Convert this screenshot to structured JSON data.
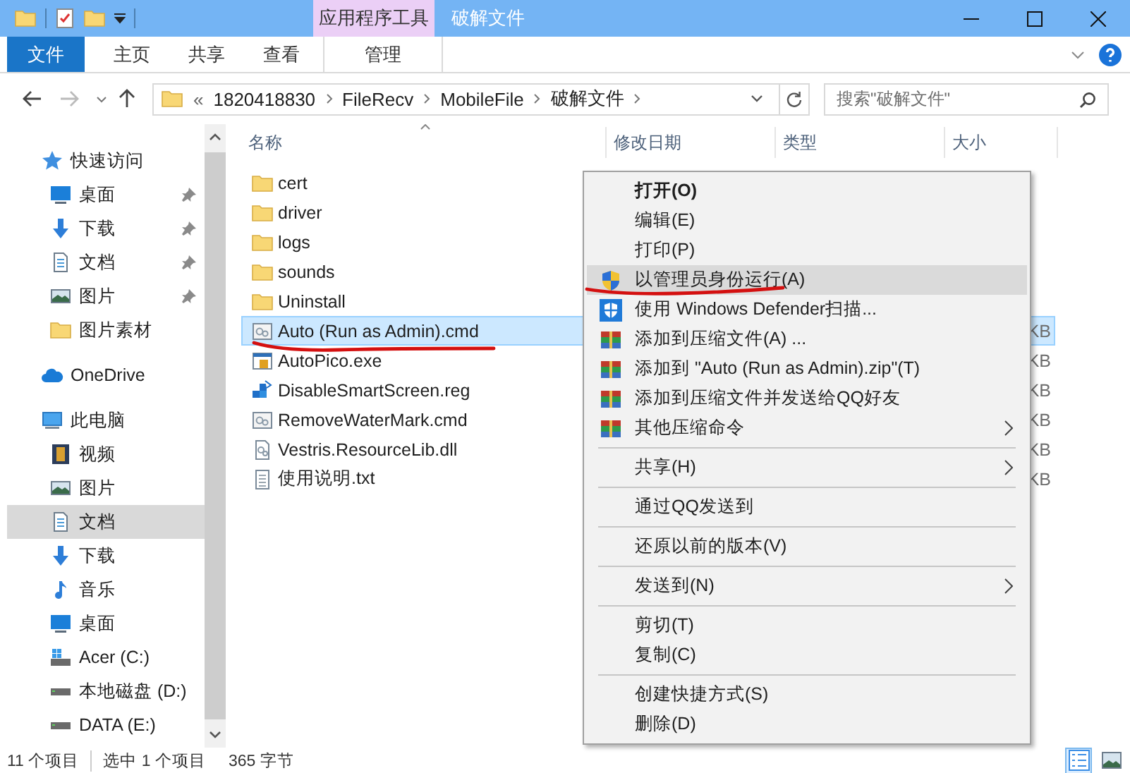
{
  "window": {
    "title": "破解文件",
    "context_group": "应用程序工具"
  },
  "ribbon": {
    "tabs": [
      {
        "label": "文件",
        "kind": "file"
      },
      {
        "label": "主页",
        "kind": "tab"
      },
      {
        "label": "共享",
        "kind": "tab"
      },
      {
        "label": "查看",
        "kind": "tab"
      },
      {
        "label": "管理",
        "kind": "context"
      }
    ]
  },
  "address": {
    "overflow": "«",
    "path": [
      "1820418830",
      "FileRecv",
      "MobileFile",
      "破解文件"
    ]
  },
  "search": {
    "placeholder": "搜索\"破解文件\""
  },
  "nav": [
    {
      "label": "快速访问",
      "kind": "star",
      "selected": false,
      "children": [
        {
          "label": "桌面",
          "kind": "desktop",
          "pinned": true,
          "selected": false
        },
        {
          "label": "下载",
          "kind": "download",
          "pinned": true,
          "selected": false
        },
        {
          "label": "文档",
          "kind": "document",
          "pinned": true,
          "selected": false
        },
        {
          "label": "图片",
          "kind": "picture",
          "pinned": true,
          "selected": false
        },
        {
          "label": "图片素材",
          "kind": "folder",
          "pinned": false,
          "selected": false
        }
      ]
    },
    {
      "label": "OneDrive",
      "kind": "cloud",
      "selected": false
    },
    {
      "label": "此电脑",
      "kind": "pc",
      "selected": false,
      "children": [
        {
          "label": "视频",
          "kind": "video",
          "pinned": false,
          "selected": false
        },
        {
          "label": "图片",
          "kind": "picture",
          "pinned": false,
          "selected": false
        },
        {
          "label": "文档",
          "kind": "document",
          "pinned": false,
          "selected": true
        },
        {
          "label": "下载",
          "kind": "download",
          "pinned": false,
          "selected": false
        },
        {
          "label": "音乐",
          "kind": "music",
          "pinned": false,
          "selected": false
        },
        {
          "label": "桌面",
          "kind": "desktop",
          "pinned": false,
          "selected": false
        },
        {
          "label": "Acer (C:)",
          "kind": "drive-win",
          "pinned": false,
          "selected": false
        },
        {
          "label": "本地磁盘 (D:)",
          "kind": "drive",
          "pinned": false,
          "selected": false
        },
        {
          "label": "DATA (E:)",
          "kind": "drive",
          "pinned": false,
          "selected": false
        }
      ]
    }
  ],
  "columns": [
    "名称",
    "修改日期",
    "类型",
    "大小"
  ],
  "files": [
    {
      "name": "cert",
      "kind": "folder",
      "selected": false
    },
    {
      "name": "driver",
      "kind": "folder",
      "selected": false
    },
    {
      "name": "logs",
      "kind": "folder",
      "selected": false
    },
    {
      "name": "sounds",
      "kind": "folder",
      "selected": false
    },
    {
      "name": "Uninstall",
      "kind": "folder",
      "selected": false
    },
    {
      "name": "Auto (Run as Admin).cmd",
      "kind": "cmd",
      "size": "KB",
      "selected": true
    },
    {
      "name": "AutoPico.exe",
      "kind": "exe",
      "size": "KB",
      "selected": false
    },
    {
      "name": "DisableSmartScreen.reg",
      "kind": "reg",
      "size": "KB",
      "selected": false
    },
    {
      "name": "RemoveWaterMark.cmd",
      "kind": "cmd",
      "size": "KB",
      "selected": false
    },
    {
      "name": "Vestris.ResourceLib.dll",
      "kind": "dll",
      "size": "KB",
      "selected": false
    },
    {
      "name": "使用说明.txt",
      "kind": "txt",
      "size": "KB",
      "selected": false
    }
  ],
  "menu": {
    "groups": [
      [
        {
          "label": "打开(O)",
          "kind": "plain",
          "default": true,
          "submenu": false,
          "selected": false
        },
        {
          "label": "编辑(E)",
          "kind": "plain",
          "default": false,
          "submenu": false,
          "selected": false
        },
        {
          "label": "打印(P)",
          "kind": "plain",
          "default": false,
          "submenu": false,
          "selected": false
        },
        {
          "label": "以管理员身份运行(A)",
          "kind": "shield",
          "default": false,
          "submenu": false,
          "selected": true
        },
        {
          "label": "使用 Windows Defender扫描...",
          "kind": "defender",
          "default": false,
          "submenu": false,
          "selected": false
        },
        {
          "label": "添加到压缩文件(A) ...",
          "kind": "archive",
          "default": false,
          "submenu": false,
          "selected": false
        },
        {
          "label": "添加到 \"Auto (Run as Admin).zip\"(T)",
          "kind": "archive",
          "default": false,
          "submenu": false,
          "selected": false
        },
        {
          "label": "添加到压缩文件并发送给QQ好友",
          "kind": "archive",
          "default": false,
          "submenu": false,
          "selected": false
        },
        {
          "label": "其他压缩命令",
          "kind": "archive",
          "default": false,
          "submenu": true,
          "selected": false
        }
      ],
      [
        {
          "label": "共享(H)",
          "default": false,
          "submenu": true,
          "selected": false
        }
      ],
      [
        {
          "label": "通过QQ发送到",
          "default": false,
          "submenu": false,
          "selected": false
        }
      ],
      [
        {
          "label": "还原以前的版本(V)",
          "default": false,
          "submenu": false,
          "selected": false
        }
      ],
      [
        {
          "label": "发送到(N)",
          "default": false,
          "submenu": true,
          "selected": false
        }
      ],
      [
        {
          "label": "剪切(T)",
          "default": false,
          "submenu": false,
          "selected": false
        },
        {
          "label": "复制(C)",
          "default": false,
          "submenu": false,
          "selected": false
        }
      ],
      [
        {
          "label": "创建快捷方式(S)",
          "default": false,
          "submenu": false,
          "selected": false
        },
        {
          "label": "删除(D)",
          "default": false,
          "submenu": false,
          "selected": false
        }
      ]
    ]
  },
  "status": [
    "11 个项目",
    "选中 1 个项目",
    "365 字节"
  ],
  "view_buttons": [
    {
      "kind": "details",
      "selected": true
    },
    {
      "kind": "large-icons",
      "selected": false
    }
  ]
}
